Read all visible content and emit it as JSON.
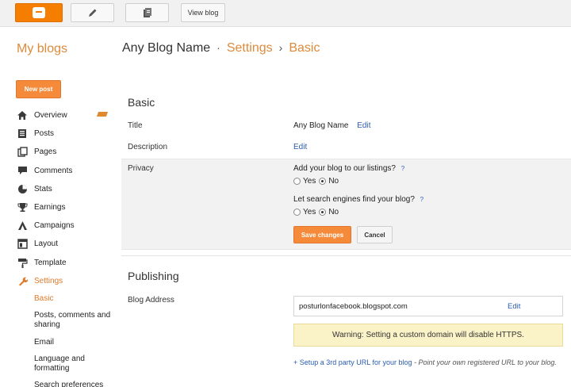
{
  "toolbar": {
    "view_blog": "View blog",
    "icons": [
      "blogger-logo-icon",
      "pencil-icon",
      "pages-icon"
    ],
    "accent": "#f57d00"
  },
  "header": {
    "my_blogs": "My blogs",
    "blog_name": "Any Blog Name",
    "sep1": "·",
    "settings": "Settings",
    "sep2": "›",
    "basic": "Basic"
  },
  "sidebar": {
    "new_post": "New post",
    "items": [
      {
        "label": "Overview",
        "icon": "house-icon"
      },
      {
        "label": "Posts",
        "icon": "posts-icon"
      },
      {
        "label": "Pages",
        "icon": "pages-icon"
      },
      {
        "label": "Comments",
        "icon": "comment-icon"
      },
      {
        "label": "Stats",
        "icon": "pie-chart-icon"
      },
      {
        "label": "Earnings",
        "icon": "trophy-icon"
      },
      {
        "label": "Campaigns",
        "icon": "campaign-icon"
      },
      {
        "label": "Layout",
        "icon": "layout-icon"
      },
      {
        "label": "Template",
        "icon": "paint-roller-icon"
      },
      {
        "label": "Settings",
        "icon": "wrench-icon"
      }
    ],
    "sub_items": [
      {
        "label": "Basic"
      },
      {
        "label": "Posts, comments and sharing"
      },
      {
        "label": "Email"
      },
      {
        "label": "Language and formatting"
      },
      {
        "label": "Search preferences"
      }
    ]
  },
  "basic": {
    "title": "Basic",
    "title_label": "Title",
    "title_value": "Any Blog Name",
    "title_edit": "Edit",
    "description_label": "Description",
    "description_edit": "Edit",
    "privacy_label": "Privacy",
    "listing_question": "Add your blog to our listings?",
    "listing_help": "?",
    "listing_yes": "Yes",
    "listing_no": "No",
    "search_question": "Let search engines find your blog?",
    "search_help": "?",
    "search_yes": "Yes",
    "search_no": "No",
    "save": "Save changes",
    "cancel": "Cancel"
  },
  "publishing": {
    "title": "Publishing",
    "address_label": "Blog Address",
    "address_value": "posturlonfacebook.blogspot.com",
    "address_edit": "Edit",
    "warning": "Warning: Setting a custom domain will disable HTTPS.",
    "setup_link": "+ Setup a 3rd party URL for your blog",
    "setup_text": " - Point your own registered URL to your blog."
  }
}
